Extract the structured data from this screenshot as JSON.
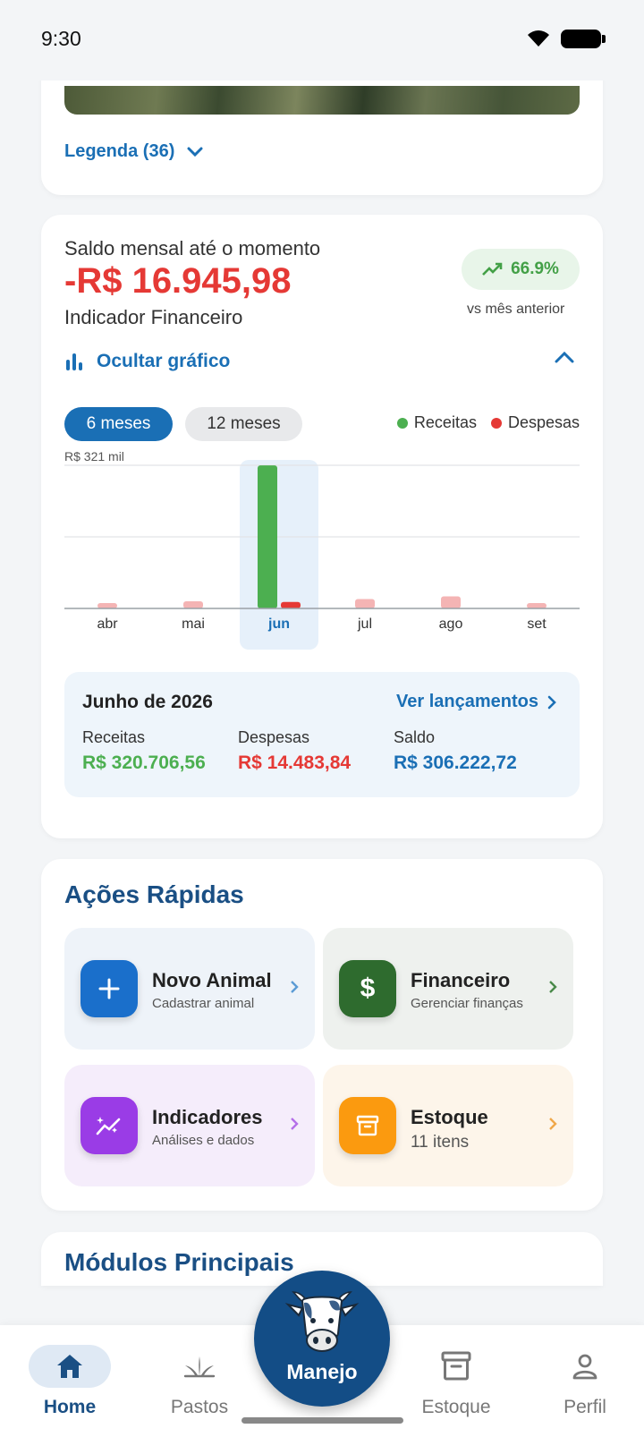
{
  "status_bar": {
    "time": "9:30"
  },
  "map": {
    "legend_label": "Legenda (36)"
  },
  "finance": {
    "label": "Saldo mensal até o momento",
    "value": "-R$ 16.945,98",
    "subtitle": "Indicador Financeiro",
    "trend": "66.9%",
    "trend_caption": "vs mês anterior",
    "toggle_label": "Ocultar gráfico",
    "period_options": [
      "6 meses",
      "12 meses"
    ],
    "selected_period": "6 meses",
    "legend": [
      {
        "name": "Receitas",
        "color": "#4caf50"
      },
      {
        "name": "Despesas",
        "color": "#e53935"
      }
    ],
    "detail": {
      "title": "Junho de 2026",
      "link": "Ver lançamentos",
      "receitas_label": "Receitas",
      "receitas_value": "R$ 320.706,56",
      "despesas_label": "Despesas",
      "despesas_value": "R$ 14.483,84",
      "saldo_label": "Saldo",
      "saldo_value": "R$ 306.222,72"
    }
  },
  "chart_data": {
    "type": "bar",
    "y_max_label": "R$ 321 mil",
    "categories": [
      "abr",
      "mai",
      "jun",
      "jul",
      "ago",
      "set"
    ],
    "selected_category": "jun",
    "ylim": [
      0,
      321000
    ],
    "series": [
      {
        "name": "Receitas",
        "values": [
          0,
          0,
          320706.56,
          0,
          0,
          0
        ],
        "color": "#4caf50"
      },
      {
        "name": "Despesas",
        "values": [
          12000,
          16000,
          14483.84,
          21000,
          27000,
          9000
        ],
        "color": "#e53935",
        "faded_color": "#f4b4b4"
      }
    ],
    "grid": true
  },
  "quick_actions": {
    "title": "Ações Rápidas",
    "items": [
      {
        "name": "Novo Animal",
        "desc": "Cadastrar animal",
        "icon": "plus-icon",
        "bg": "#eef3f9",
        "icon_bg": "#1a6fcb",
        "chev": "#5b9bd5"
      },
      {
        "name": "Financeiro",
        "desc": "Gerenciar finanças",
        "icon": "dollar-icon",
        "bg": "#eef1ee",
        "icon_bg": "#2e6b2e",
        "chev": "#4a8a4a"
      },
      {
        "name": "Indicadores",
        "desc": "Análises e dados",
        "icon": "sparkle-chart-icon",
        "bg": "#f5edfb",
        "icon_bg": "#9a3ce6",
        "chev": "#b46ee8"
      },
      {
        "name": "Estoque",
        "desc": "11 itens",
        "icon": "archive-icon",
        "bg": "#fdf5ea",
        "icon_bg": "#fb9a0f",
        "chev": "#f0a84a"
      }
    ]
  },
  "modules": {
    "title": "Módulos Principais"
  },
  "bottom_nav": {
    "items": [
      {
        "label": "Home",
        "icon": "home-icon",
        "active": true
      },
      {
        "label": "Pastos",
        "icon": "grass-icon",
        "active": false
      },
      {
        "label": "Estoque",
        "icon": "archive-icon",
        "active": false
      },
      {
        "label": "Perfil",
        "icon": "person-icon",
        "active": false
      }
    ],
    "center_label": "Manejo",
    "center_icon": "cow-icon"
  }
}
